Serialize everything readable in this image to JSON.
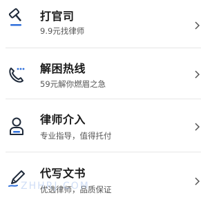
{
  "items": [
    {
      "title": "打官司",
      "subtitle": "9.9元找律师",
      "icon": "gavel-icon"
    },
    {
      "title": "解困热线",
      "subtitle": "59元解你燃眉之急",
      "icon": "phone-call-icon"
    },
    {
      "title": "律师介入",
      "subtitle": "专业指导，值得托付",
      "icon": "lawyer-person-icon"
    },
    {
      "title": "代写文书",
      "subtitle": "优选律师，品质保证",
      "icon": "pen-nib-icon"
    }
  ],
  "colors": {
    "icon_dark": "#1f2a3a",
    "icon_accent": "#2f6fdb",
    "title": "#1a1a1a",
    "subtitle": "#555555",
    "divider": "#e6e6e6",
    "chevron": "#555555"
  },
  "watermark": {
    "text": "ZHHRJ.COM"
  }
}
